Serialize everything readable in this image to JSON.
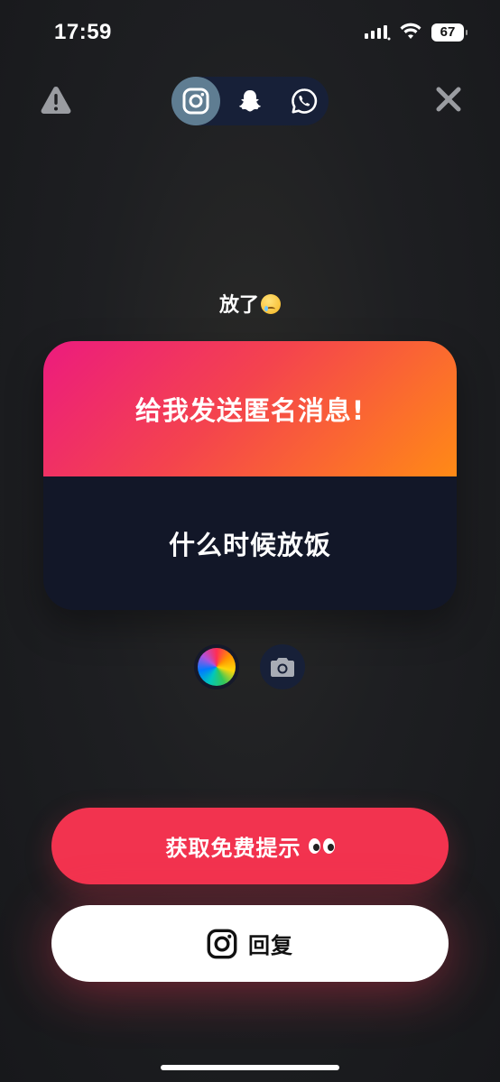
{
  "status_bar": {
    "time": "17:59",
    "battery": "67"
  },
  "top_bar": {
    "share_targets": [
      {
        "name": "instagram",
        "icon": "instagram-icon",
        "selected": true
      },
      {
        "name": "snapchat",
        "icon": "snapchat-icon",
        "selected": false
      },
      {
        "name": "whatsapp",
        "icon": "whatsapp-icon",
        "selected": false
      }
    ],
    "warning_icon": "warning-icon",
    "close_icon": "close-icon"
  },
  "question": {
    "text": "放了",
    "emoji": "face-holding-back-tears"
  },
  "card": {
    "prompt": "给我发送匿名消息!",
    "message": "什么时候放饭"
  },
  "tools": {
    "color_icon": "color-wheel-icon",
    "camera_icon": "camera-icon"
  },
  "actions": {
    "hint_label": "获取免费提示",
    "hint_emoji": "eyes",
    "reply_label": "回复",
    "reply_icon": "instagram-icon"
  },
  "colors": {
    "accent_red": "#f2334f",
    "card_gradient_start": "#ec1b7e",
    "card_gradient_end": "#ff8a16",
    "card_body": "#121728",
    "selected_share": "#5f7d92"
  }
}
